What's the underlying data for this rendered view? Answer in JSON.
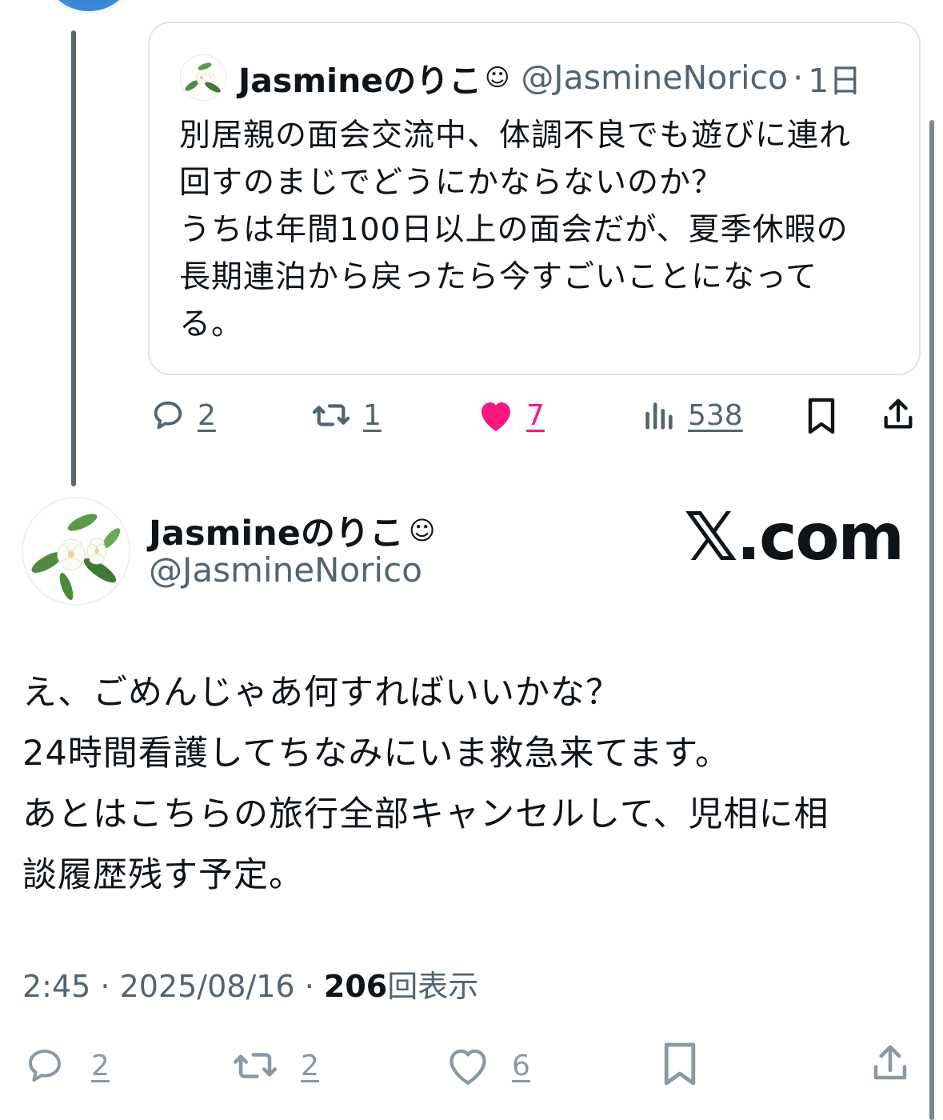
{
  "quoted_tweet": {
    "name": "Jasmineのりこ",
    "name_emoji": "☺",
    "handle": "@JasmineNorico",
    "separator": "·",
    "time": "1日",
    "avatar_icon": "jasmine-flower-icon",
    "body_lines": [
      "別居親の面会交流中、体調不良でも遊びに連れ",
      "回すのまじでどうにかならないのか？",
      "うちは年間100日以上の面会だが、夏季休暇の",
      "長期連泊から戻ったら今すごいことになって",
      "る。"
    ],
    "actions": {
      "reply_count": "2",
      "retweet_count": "1",
      "like_count": "7",
      "views_count": "538"
    }
  },
  "main_tweet": {
    "name": "Jasmineのりこ",
    "name_emoji": "☺",
    "handle": "@JasmineNorico",
    "watermark": ".com",
    "watermark_x": "𝕏",
    "body_lines": [
      "え、ごめんじゃあ何すればいいかな？",
      "24時間看護してちなみにいま救急来てます。",
      "あとはこちらの旅行全部キャンセルして、児相に相",
      "談履歴残す予定。"
    ],
    "meta": {
      "time": "2:45",
      "sep1": " · ",
      "date": "2025/08/16",
      "sep2": " · ",
      "views": "206",
      "views_label": "回表示"
    },
    "actions": {
      "reply_count": "2",
      "retweet_count": "2",
      "like_count": "6"
    }
  },
  "colors": {
    "text": "#0f1419",
    "secondary": "#536471",
    "like_pink": "#f91880",
    "border": "#dfe4e8"
  }
}
